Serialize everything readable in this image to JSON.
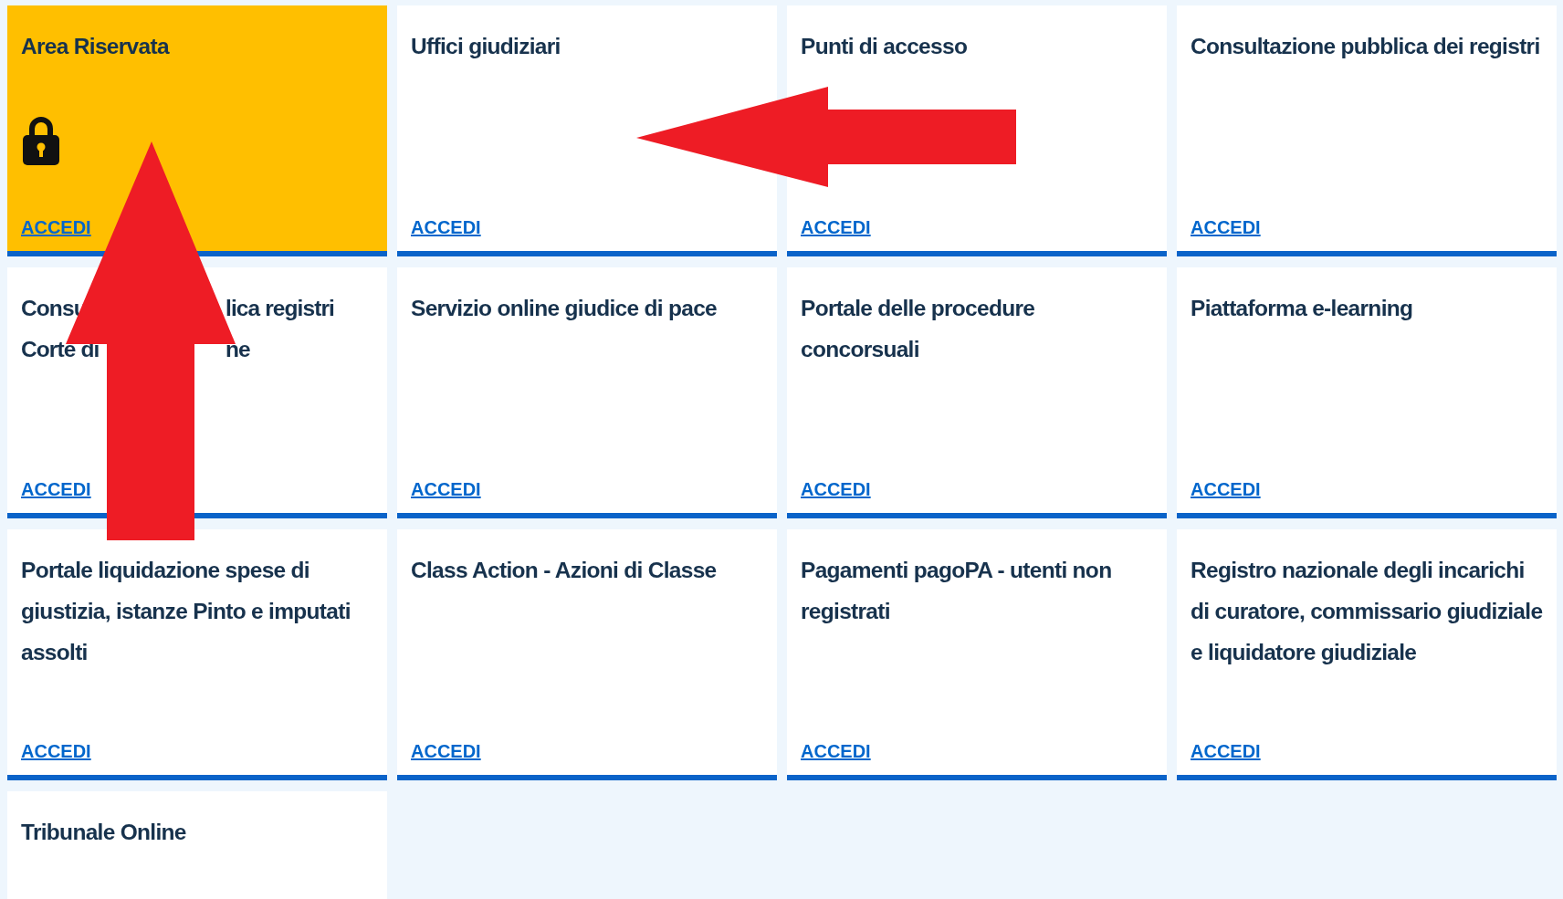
{
  "cards": [
    {
      "kind": "restricted",
      "title": "Area Riservata",
      "highlighted": true,
      "link": "ACCEDI"
    },
    {
      "kind": "standard",
      "title": "Uffici giudiziari",
      "highlighted": false,
      "link": "ACCEDI"
    },
    {
      "kind": "standard",
      "title": "Punti di accesso",
      "highlighted": false,
      "link": "ACCEDI"
    },
    {
      "kind": "standard",
      "title": "Consultazione pubblica dei registri",
      "highlighted": false,
      "link": "ACCEDI"
    },
    {
      "kind": "covered",
      "title_fragments": [
        [
          "Consu",
          "lica registri"
        ],
        [
          "Corte di",
          "ne"
        ]
      ],
      "highlighted": false,
      "link": "ACCEDI"
    },
    {
      "kind": "standard",
      "title": "Servizio online giudice di pace",
      "highlighted": false,
      "link": "ACCEDI"
    },
    {
      "kind": "standard",
      "title": "Portale delle procedure concorsuali",
      "highlighted": false,
      "link": "ACCEDI"
    },
    {
      "kind": "standard",
      "title": "Piattaforma e-learning",
      "highlighted": false,
      "link": "ACCEDI"
    },
    {
      "kind": "standard",
      "title": "Portale liquidazione spese di giustizia, istanze Pinto e imputati assolti",
      "highlighted": false,
      "link": "ACCEDI"
    },
    {
      "kind": "standard",
      "title": "Class Action - Azioni di Classe",
      "highlighted": false,
      "link": "ACCEDI"
    },
    {
      "kind": "standard",
      "title": "Pagamenti pagoPA - utenti non registrati",
      "highlighted": false,
      "link": "ACCEDI"
    },
    {
      "kind": "standard",
      "title": "Registro nazionale degli incarichi di curatore, commissario giudiziale e liquidatore giudiziale",
      "highlighted": false,
      "link": "ACCEDI"
    },
    {
      "kind": "standard",
      "title": "Tribunale Online",
      "highlighted": false
    }
  ]
}
